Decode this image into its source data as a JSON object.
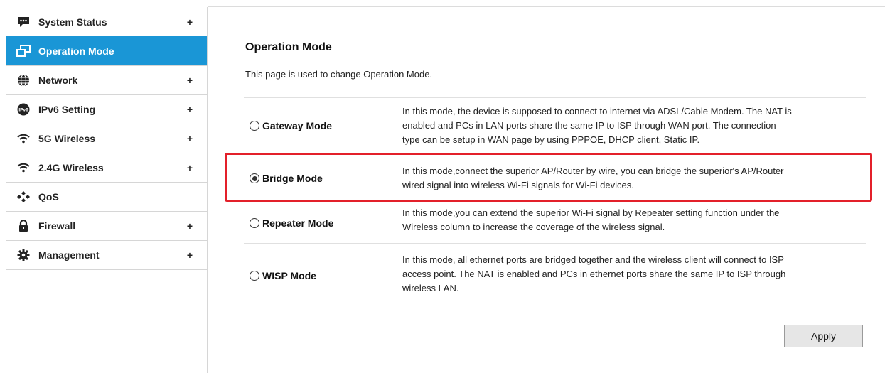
{
  "sidebar": {
    "items": [
      {
        "label": "System Status",
        "icon": "chat-icon",
        "plus": "+"
      },
      {
        "label": "Operation Mode",
        "icon": "windows-icon",
        "plus": ""
      },
      {
        "label": "Network",
        "icon": "globe-icon",
        "plus": "+"
      },
      {
        "label": "IPv6 Setting",
        "icon": "ipv6-icon",
        "icon_text": "IPv6",
        "plus": "+"
      },
      {
        "label": "5G Wireless",
        "icon": "wifi-icon",
        "plus": "+"
      },
      {
        "label": "2.4G Wireless",
        "icon": "wifi-icon",
        "plus": "+"
      },
      {
        "label": "QoS",
        "icon": "qos-icon",
        "plus": ""
      },
      {
        "label": "Firewall",
        "icon": "lock-icon",
        "plus": "+"
      },
      {
        "label": "Management",
        "icon": "gear-icon",
        "plus": "+"
      }
    ],
    "active_index": 1,
    "active_color": "#1a96d6"
  },
  "main": {
    "title": "Operation Mode",
    "description": "This page is used to change Operation Mode.",
    "modes": [
      {
        "label": "Gateway Mode",
        "selected": false,
        "desc_lines": [
          "In this mode, the device is supposed to connect to internet via ADSL/Cable Modem. The NAT is",
          "enabled and PCs in LAN ports share the same IP to ISP through WAN port. The connection",
          "type can be setup in WAN page by using PPPOE, DHCP client, Static IP."
        ]
      },
      {
        "label": "Bridge Mode",
        "selected": true,
        "desc_lines": [
          "In this mode,connect the superior AP/Router by wire, you can bridge the superior's AP/Router",
          "wired signal into wireless Wi-Fi signals for Wi-Fi devices."
        ]
      },
      {
        "label": "Repeater Mode",
        "selected": false,
        "desc_lines": [
          "In this mode,you can extend the superior Wi-Fi signal by Repeater setting function under the",
          "Wireless column to increase the coverage of the wireless signal."
        ]
      },
      {
        "label": "WISP Mode",
        "selected": false,
        "desc_lines": [
          "In this mode, all ethernet ports are bridged together and the wireless client will connect to ISP",
          "access point. The NAT is enabled and PCs in ethernet ports share the same IP to ISP through",
          "wireless LAN."
        ]
      }
    ],
    "apply_label": "Apply",
    "highlight_color": "#e3202a"
  }
}
